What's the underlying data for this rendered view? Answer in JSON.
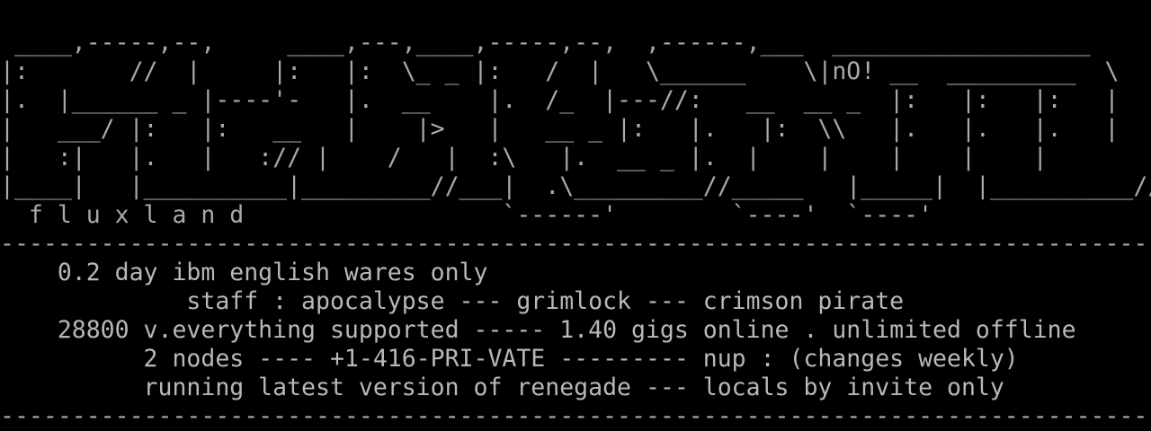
{
  "terminal": {
    "foreground": "#aaaaaa",
    "background": "#000000",
    "logo": {
      "lines": [
        " ____,-----,--,     ____,---,____,-----,--,  ,------,___  __________________",
        "|:       //  |     |:   |:  \\_ _ |:   /  |   \\______    \\|nO! __  _________  \\",
        "|.  |______ _ |----'-   |.  __    |.  /_  |---//:   __  __ _  |:   |:   |:   |",
        "|   ___/ |:   |:   __   |    |>   |   __ _ |:   |.   |:  \\\\   |.   |.   |.   |",
        "|   :|   |.   |   :// |    /   |  :\\   |.  __ _ |.  |    |    |    |    |",
        "|____|   |__________|_________//___|  .\\_________//_____   |_____|  |__________//",
        "  f l u x l a n d                  `------'        `----'  `----'"
      ]
    },
    "separator_top": "--------------------------------------------------------------------------------",
    "info": {
      "line1": "    0.2 day ibm english wares only",
      "line2": "             staff : apocalypse --- grimlock --- crimson pirate",
      "line3": "    28800 v.everything supported ----- 1.40 gigs online . unlimited offline",
      "line4": "          2 nodes ---- +1-416-PRI-VATE --------- nup : (changes weekly)",
      "line5": "          running latest version of renegade --- locals by invite only"
    },
    "separator_bottom": "--------------------------------------------------------------------------------"
  }
}
